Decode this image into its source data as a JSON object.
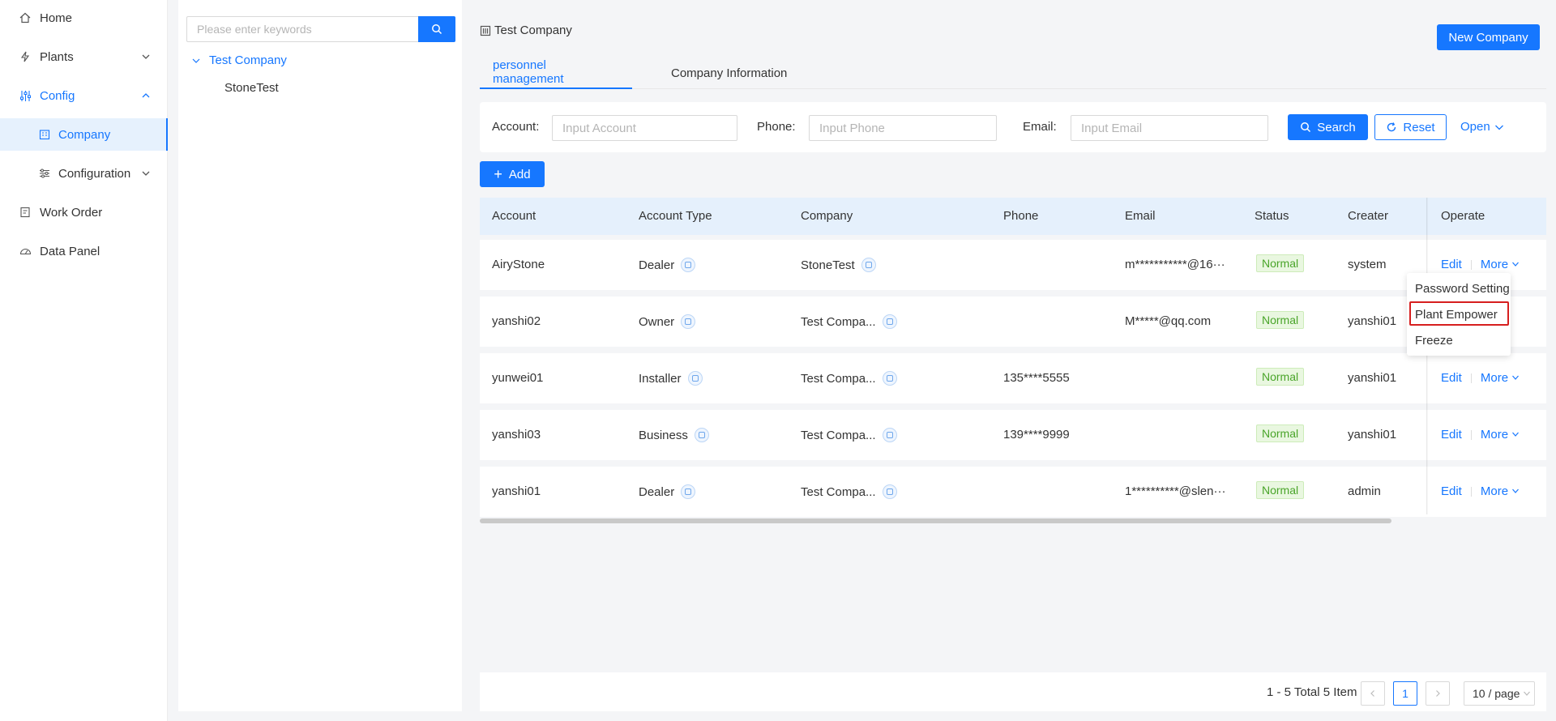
{
  "sidebar": {
    "items": [
      {
        "label": "Home",
        "icon": "home-icon"
      },
      {
        "label": "Plants",
        "icon": "lightning-icon"
      },
      {
        "label": "Config",
        "icon": "sliders-icon"
      },
      {
        "label": "Company",
        "icon": "building-icon"
      },
      {
        "label": "Configuration",
        "icon": "settings-lines-icon"
      },
      {
        "label": "Work Order",
        "icon": "clipboard-icon"
      },
      {
        "label": "Data Panel",
        "icon": "gauge-icon"
      }
    ]
  },
  "tree": {
    "search_placeholder": "Please enter keywords",
    "root": "Test Company",
    "child": "StoneTest"
  },
  "header": {
    "breadcrumb": "Test Company",
    "new_button": "New Company",
    "tabs": [
      "personnel management",
      "Company Information"
    ]
  },
  "filter": {
    "account_label": "Account",
    "account_placeholder": "Input Account",
    "phone_label": "Phone",
    "phone_placeholder": "Input Phone",
    "email_label": "Email",
    "email_placeholder": "Input Email",
    "search": "Search",
    "reset": "Reset",
    "open": "Open"
  },
  "add_button": "Add",
  "table": {
    "columns": [
      "Account",
      "Account Type",
      "Company",
      "Phone",
      "Email",
      "Status",
      "Creater",
      "Operate"
    ],
    "rows": [
      {
        "account": "AiryStone",
        "type": "Dealer",
        "company": "StoneTest",
        "phone": "",
        "email": "m***********@16···",
        "status": "Normal",
        "creater": "system"
      },
      {
        "account": "yanshi02",
        "type": "Owner",
        "company": "Test Compa...",
        "phone": "",
        "email": "M*****@qq.com",
        "status": "Normal",
        "creater": "yanshi01"
      },
      {
        "account": "yunwei01",
        "type": "Installer",
        "company": "Test Compa...",
        "phone": "135****5555",
        "email": "",
        "status": "Normal",
        "creater": "yanshi01"
      },
      {
        "account": "yanshi03",
        "type": "Business",
        "company": "Test Compa...",
        "phone": "139****9999",
        "email": "",
        "status": "Normal",
        "creater": "yanshi01"
      },
      {
        "account": "yanshi01",
        "type": "Dealer",
        "company": "Test Compa...",
        "phone": "",
        "email": "1**********@slen···",
        "status": "Normal",
        "creater": "admin"
      }
    ],
    "edit": "Edit",
    "more": "More"
  },
  "dropdown": {
    "items": [
      "Password Setting",
      "Plant Empower",
      "Freeze"
    ]
  },
  "pager": {
    "info": "1 - 5 Total 5 Item",
    "page": "1",
    "size": "10 / page"
  },
  "colors": {
    "accent": "#1677ff",
    "highlight": "#d61f1f",
    "status": "#4aa52a"
  }
}
